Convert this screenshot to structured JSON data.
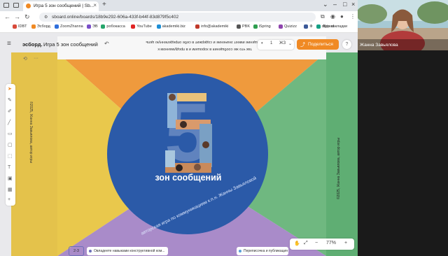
{
  "browser": {
    "tab_title": "Игра 5 зон сообщений | Sb...",
    "tab_close": "×",
    "tab_add": "+",
    "address": "sboard.online/boards/18b9e292-606a-433f-b44f-83d879f5c402",
    "bookmarks": [
      {
        "label": "IDBT",
        "color": "#d84a3a"
      },
      {
        "label": "Эсборд",
        "color": "#f08a24"
      },
      {
        "label": "ZoomZhanna",
        "color": "#2f6fdc"
      },
      {
        "label": "ЭВ",
        "color": "#7a4fc9"
      },
      {
        "label": "робокасса",
        "color": "#25a56b"
      },
      {
        "label": "YouTube",
        "color": "#e02424"
      },
      {
        "label": "akademiki.biz",
        "color": "#1e8fd6"
      },
      {
        "label": "info@akademiki",
        "color": "#c0392b"
      },
      {
        "label": "PBK",
        "color": "#555555"
      },
      {
        "label": "iSpring",
        "color": "#2e9e4f"
      },
      {
        "label": "Quizizz",
        "color": "#8e44ad"
      },
      {
        "label": "Ф",
        "color": "#3b5998"
      },
      {
        "label": "digipad",
        "color": "#16a085"
      }
    ],
    "all_bookmarks": "Все закладки"
  },
  "board": {
    "brand": "эсборд.",
    "title": "Игра 5 зон сообщений",
    "share_label": "Поделиться",
    "help": "?",
    "zoom": "77%",
    "pill_left": "1",
    "pill_mid": "ЖЗ",
    "card": {
      "number": "5",
      "title": "зон сообщений",
      "arc_text": "авторская игра по коммуникациям к.п.н. Жанны Завьяловой"
    },
    "side_left_text": "©2025, Жанна Завьялова, автор игры",
    "side_right_text": "©2025, Жанна Завьялова, автор игры",
    "mirror_top_1": "каждое сообщение имеет значение и содержит в себе определенную цель",
    "mirror_top_2": "так что же сообщения в хорошем и в продуманном к",
    "badge": "2-3",
    "note_left": "Овладеете навыками конструктивной ком...",
    "note_right": "Переписочка и публикация"
  },
  "webcam": {
    "name": "Жанна Завьялова"
  },
  "colors": {
    "orange": "#ef9a3d",
    "green": "#6fb880",
    "yellow": "#e9c84c",
    "purple": "#a98bc9",
    "blue": "#2b5aa8",
    "accent": "#f08a24"
  }
}
